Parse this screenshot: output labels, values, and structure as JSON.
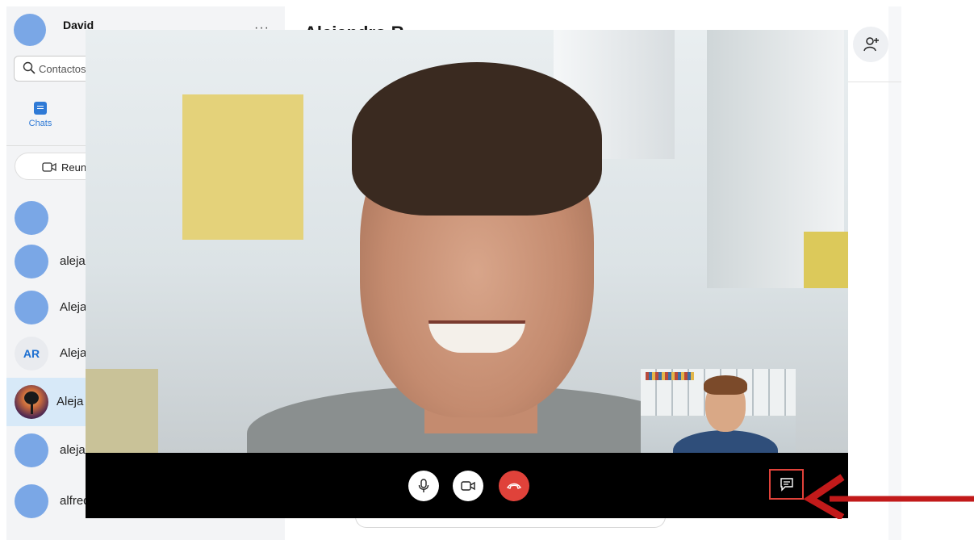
{
  "sidebar": {
    "profile_name": "David",
    "more_label": "···",
    "search_placeholder": "Contactos",
    "tab_chats": "Chats",
    "meet_button": "Reun",
    "contacts": [
      {
        "name": "",
        "avatar": "blank"
      },
      {
        "name": "aleja",
        "avatar": "blank"
      },
      {
        "name": "Aleja",
        "avatar": "blank"
      },
      {
        "name": "Aleja",
        "avatar": "initials",
        "initials": "AR"
      },
      {
        "name": "Aleja",
        "avatar": "photo",
        "selected": true
      },
      {
        "name": "alejar",
        "avatar": "blank"
      },
      {
        "name": "alfred",
        "avatar": "blank"
      }
    ]
  },
  "chat": {
    "title": "Alejandro R"
  },
  "call": {
    "controls": [
      "microphone",
      "camera",
      "hang-up",
      "open-chat"
    ]
  },
  "colors": {
    "accent": "#2f7ad6",
    "avatar_blue": "#7aa7e6",
    "end_call_red": "#e0423a",
    "highlight_box": "#e0423a",
    "arrow": "#c21a1a",
    "selected_row": "#d7e9f8"
  },
  "icons": [
    "search-icon",
    "chat-icon",
    "video-meet-icon",
    "add-person-icon",
    "microphone-icon",
    "camera-icon",
    "hang-up-icon",
    "chat-toggle-icon",
    "arrow-annotation"
  ]
}
